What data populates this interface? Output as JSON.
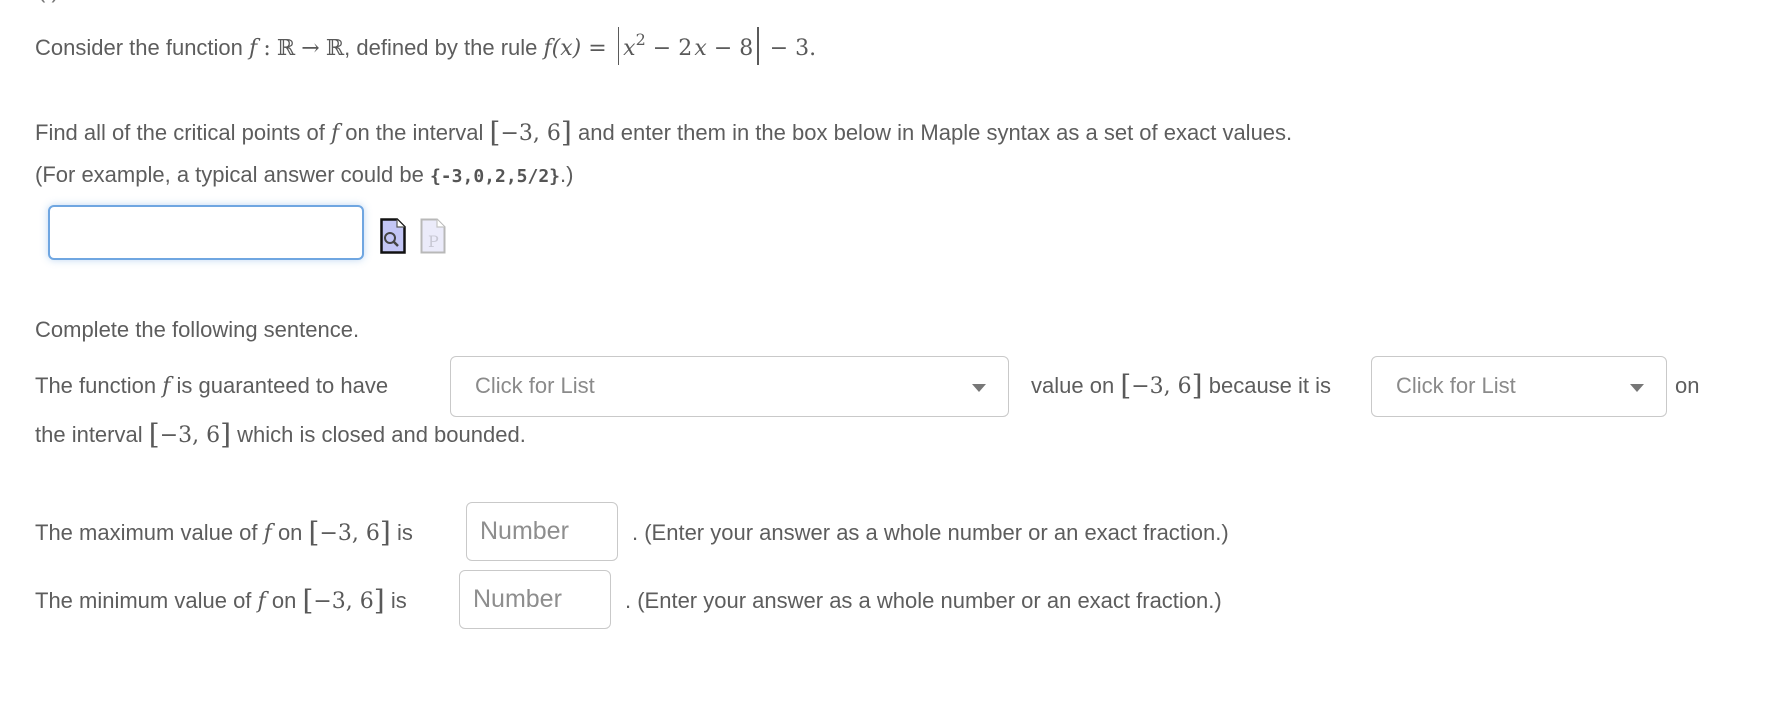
{
  "clipped_header_fragment": "(            )",
  "problem": {
    "intro_prefix": "Consider the function",
    "intro_fn": "f",
    "intro_colon": ":",
    "domain": "ℝ",
    "arrow": "→",
    "codomain": "ℝ",
    "intro_mid": ", defined by the rule",
    "rule_lhs": "f(x) =",
    "rule_abs_inner_x": "x",
    "rule_abs_inner_exp": "2",
    "rule_abs_inner_rest_a": " − 2",
    "rule_abs_inner_x2": "x",
    "rule_abs_inner_rest_b": " − 8",
    "rule_tail": " − 3."
  },
  "part1": {
    "instruction_a": "Find all of the critical points of",
    "instruction_fn": "f",
    "instruction_b": "on the interval",
    "interval": "−3, 6",
    "instruction_c": "and enter them in the box below in Maple syntax as a set of exact values.",
    "example_prefix": "(For example, a typical answer could be ",
    "example_code": "{-3,0,2,5/2}",
    "example_suffix": ".)",
    "answer_value": "",
    "answer_placeholder": "",
    "preview_icon": "preview-document-magnifier-icon",
    "syntax_icon": "syntax-document-p-icon"
  },
  "part2": {
    "heading": "Complete the following sentence.",
    "sentence_a": "The function",
    "sentence_fn": "f",
    "sentence_b": "is guaranteed to have",
    "select1_placeholder": "Click for List",
    "sentence_c": "value on",
    "interval": "−3, 6",
    "sentence_d": "because it is",
    "select2_placeholder": "Click for List",
    "sentence_e": "on",
    "sentence_f": "the interval",
    "sentence_g": "which is closed and bounded."
  },
  "part3": {
    "max_label_a": "The maximum value of",
    "max_fn": "f",
    "max_label_b": "on",
    "interval": "−3, 6",
    "max_label_c": "is",
    "max_placeholder": "Number",
    "max_value": "",
    "max_hint": ". (Enter your answer as a whole number or an exact fraction.)",
    "min_label_a": "The minimum value of",
    "min_fn": "f",
    "min_label_b": "on",
    "min_label_c": "is",
    "min_placeholder": "Number",
    "min_value": "",
    "min_hint": ". (Enter your answer as a whole number or an exact fraction.)"
  },
  "colors": {
    "text": "#5d5d5d",
    "focus_border": "#6fa6e1",
    "input_border": "#c9c9c9",
    "preview_icon_fill": "#c3c6f5",
    "syntax_icon_fill": "#ebebfa"
  }
}
